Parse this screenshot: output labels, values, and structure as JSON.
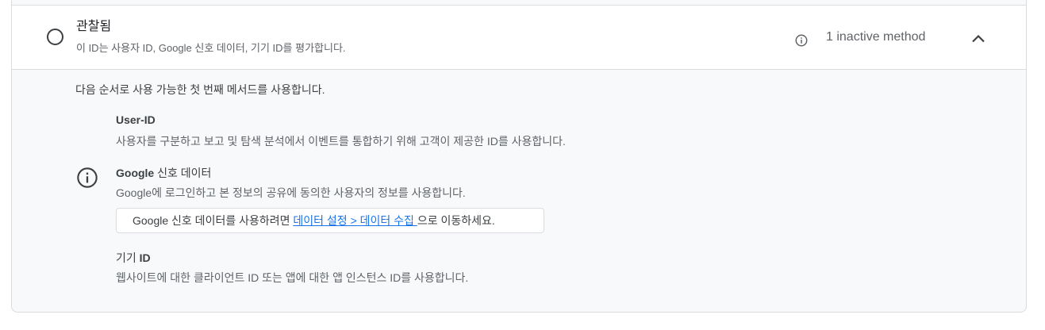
{
  "section": {
    "title": "관찰됨",
    "subtitle": "이 ID는 사용자 ID, Google 신호 데이터, 기기 ID를 평가합니다.",
    "inactive_label": "1 inactive method",
    "info_icon": "info-outline-icon",
    "chevron_icon": "chevron-up-icon"
  },
  "intro": "다음 순서로 사용 가능한 첫 번째 메서드를 사용합니다.",
  "methods": [
    {
      "title": "User-ID",
      "description": "사용자를 구분하고 보고 및 탐색 분석에서 이벤트를 통합하기 위해 고객이 제공한 ID를 사용합니다."
    },
    {
      "title_bold": "Google",
      "title_regular": " 신호 데이터",
      "description": "Google에 로그인하고 본 정보의 공유에 동의한 사용자의 정보를 사용합니다.",
      "notice_prefix": "Google 신호 데이터를 사용하려면 ",
      "notice_link": "데이터 설정 > 데이터 수집 ",
      "notice_suffix": "으로 이동하세요.",
      "icon": "info-outline-icon"
    },
    {
      "title_regular": "기기 ",
      "title_bold": "ID",
      "description": "웹사이트에 대한 클라이언트 ID 또는 앱에 대한 앱 인스턴스 ID를 사용합니다."
    }
  ],
  "colors": {
    "link": "#1a73e8",
    "panel_bg": "#f8f9fa",
    "border": "#dadce0"
  }
}
